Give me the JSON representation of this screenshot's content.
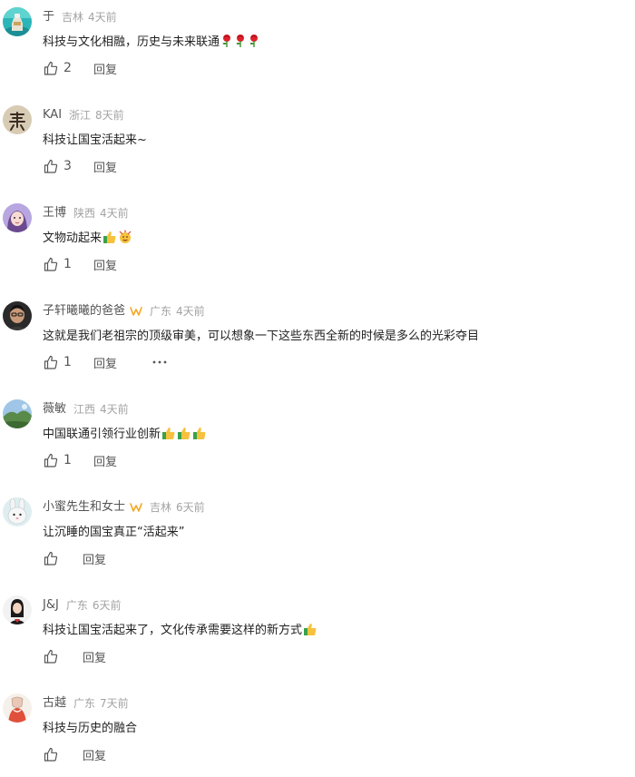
{
  "labels": {
    "reply": "回复"
  },
  "colors": {
    "meta_gray": "#a3a3a3",
    "name_gray": "#555555",
    "text_dark": "#222222",
    "badge_orange": "#f5a623"
  },
  "comments": [
    {
      "username": "于",
      "location": "吉林",
      "time": "4天前",
      "text": "科技与文化相融，历史与未来联通",
      "emojis": [
        "rose-icon",
        "rose-icon",
        "rose-icon"
      ],
      "likes": "2",
      "avatar": "teal-bottle-avatar"
    },
    {
      "username": "KAI",
      "location": "浙江",
      "time": "8天前",
      "text": "科技让国宝活起来~",
      "emojis": [],
      "likes": "3",
      "avatar": "calligraphy-avatar"
    },
    {
      "username": "王博",
      "location": "陕西",
      "time": "4天前",
      "text": "文物动起来",
      "emojis": [
        "thumbs-up-emoji-icon",
        "celebrate-emoji-icon"
      ],
      "likes": "1",
      "avatar": "anime-girl-avatar"
    },
    {
      "username": "子轩曦曦的爸爸",
      "location": "广东",
      "time": "4天前",
      "text": "这就是我们老祖宗的顶级审美，可以想象一下这些东西全新的时候是多么的光彩夺目",
      "emojis": [],
      "likes": "1",
      "avatar": "man-portrait-avatar",
      "badge": true,
      "more": true
    },
    {
      "username": "薇敏",
      "location": "江西",
      "time": "4天前",
      "text": "中国联通引领行业创新",
      "emojis": [
        "thumbs-up-emoji-icon",
        "thumbs-up-emoji-icon",
        "thumbs-up-emoji-icon"
      ],
      "likes": "1",
      "avatar": "landscape-avatar"
    },
    {
      "username": "小蜜先生和女士",
      "location": "吉林",
      "time": "6天前",
      "text": "让沉睡的国宝真正“活起来”",
      "emojis": [],
      "likes": "",
      "avatar": "bunny-avatar",
      "badge": true
    },
    {
      "username": "J&J",
      "location": "广东",
      "time": "6天前",
      "text": "科技让国宝活起来了，文化传承需要这样的新方式",
      "emojis": [
        "thumbs-up-emoji-icon"
      ],
      "likes": "",
      "avatar": "woman-portrait-avatar"
    },
    {
      "username": "古越",
      "location": "广东",
      "time": "7天前",
      "text": "科技与历史的融合",
      "emojis": [],
      "likes": "",
      "avatar": "sketch-figure-avatar"
    }
  ]
}
